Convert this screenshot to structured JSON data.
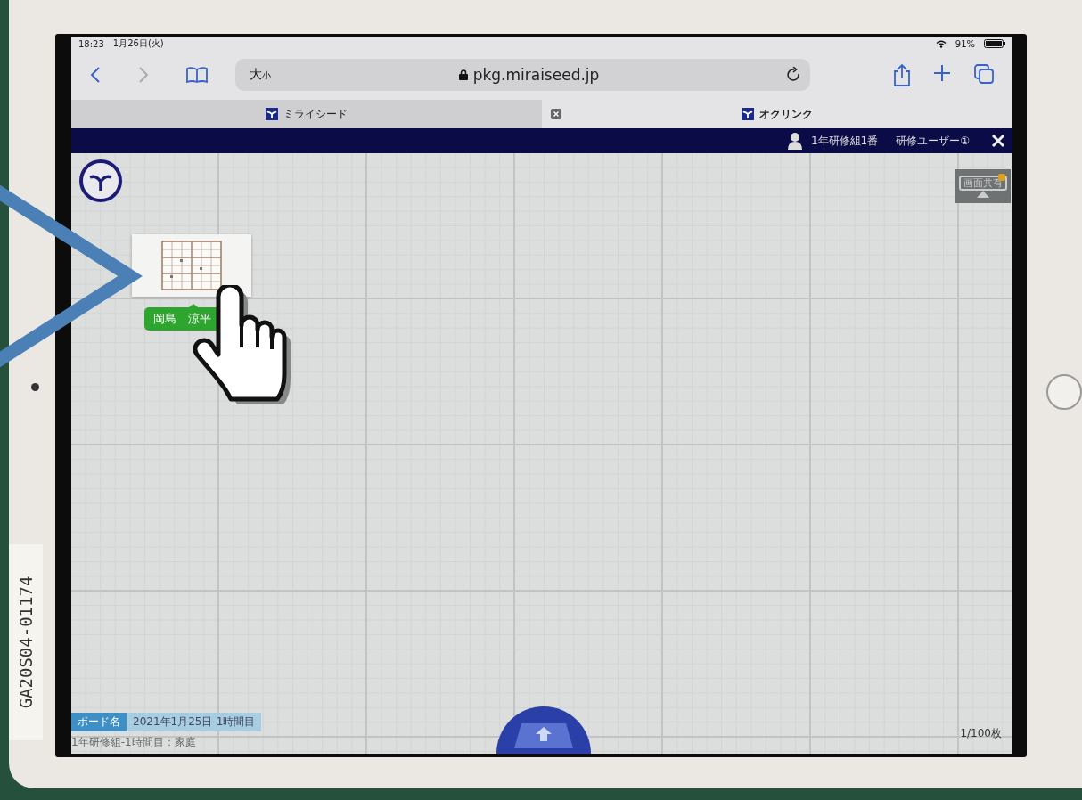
{
  "status_bar": {
    "time": "18:23",
    "date": "1月26日(火)",
    "battery": "91%"
  },
  "toolbar": {
    "text_size": {
      "large": "大",
      "small": "小"
    },
    "url": "pkg.miraiseed.jp"
  },
  "tabs": [
    {
      "title": "ミライシード",
      "selected": false
    },
    {
      "title": "オクリンク",
      "selected": true
    }
  ],
  "app_header": {
    "class_name": "1年研修組1番",
    "user_name": "研修ユーザー①"
  },
  "board": {
    "screen_share_label": "画面共有",
    "cards": [
      {
        "owner": "岡島　涼平"
      }
    ],
    "board_name_label": "ボード名",
    "board_name": "2021年1月25日-1時間目",
    "class_lesson": "1年研修組-1時間目：家庭",
    "page_count": "1/100枚"
  },
  "device": {
    "asset_tag": "GA20S04-01174"
  }
}
